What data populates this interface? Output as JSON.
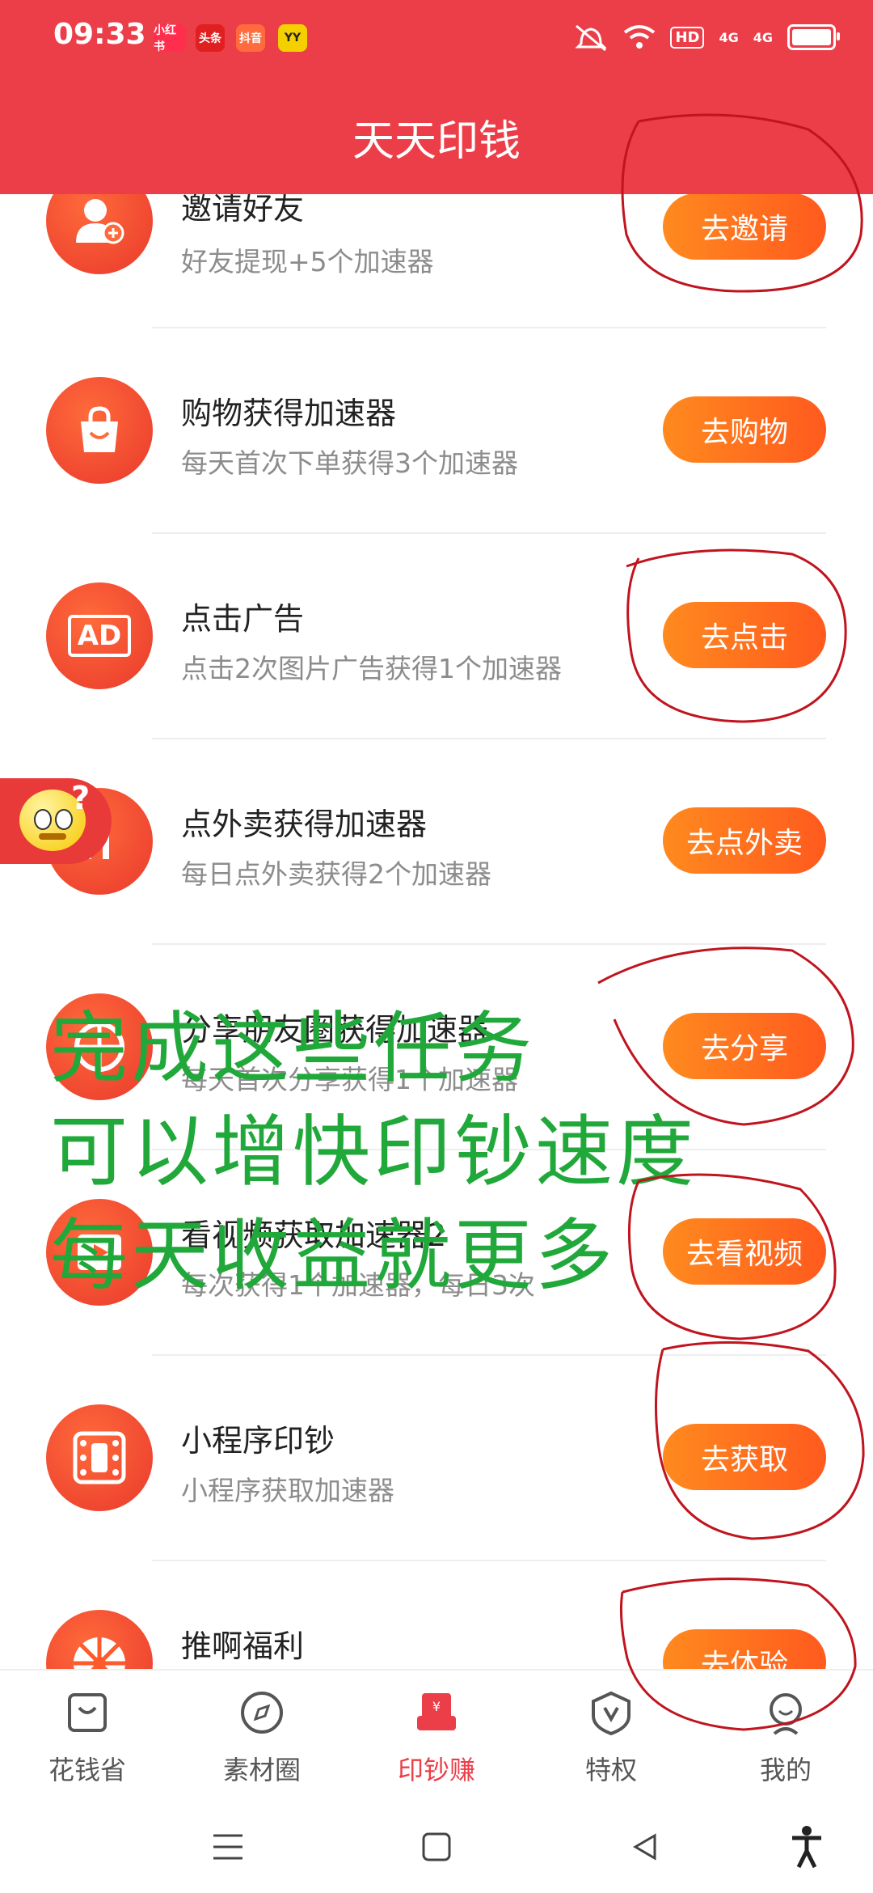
{
  "status_bar": {
    "time": "09:33",
    "notif_icons": [
      "小红书",
      "头条",
      "抖音",
      "YY"
    ],
    "hd_label": "HD",
    "signal1": "4G",
    "signal2": "4G"
  },
  "header": {
    "title": "天天印钱"
  },
  "tasks": [
    {
      "name": "邀请好友",
      "desc": "好友提现+5个加速器",
      "button": "去邀请",
      "icon": "add-user-icon"
    },
    {
      "name": "购物获得加速器",
      "desc": "每天首次下单获得3个加速器",
      "button": "去购物",
      "icon": "shopping-bag-icon"
    },
    {
      "name": "点击广告",
      "desc": "点击2次图片广告获得1个加速器",
      "button": "去点击",
      "icon": "ad-icon",
      "icon_text": "AD"
    },
    {
      "name": "点外卖获得加速器",
      "desc": "每日点外卖获得2个加速器",
      "button": "去点外卖",
      "icon": "food-delivery-icon"
    },
    {
      "name": "分享朋友圈获得加速器",
      "desc": "每天首次分享获得1个加速器",
      "button": "去分享",
      "icon": "moments-icon"
    },
    {
      "name": "看视频获取加速器2",
      "desc": "每次获得1个加速器，每日3次",
      "button": "去看视频",
      "icon": "video-icon"
    },
    {
      "name": "小程序印钞",
      "desc": "小程序获取加速器",
      "button": "去获取",
      "icon": "mini-program-icon"
    },
    {
      "name": "推啊福利",
      "desc": "",
      "button": "去体验",
      "icon": "wheel-icon"
    }
  ],
  "floating_widget": {
    "icon": "confused-emoji-icon",
    "mark": "?"
  },
  "overlay_text": [
    "完成这些任务",
    "可以增快印钞速度",
    "每天收益就更多"
  ],
  "tabbar": [
    {
      "label": "花钱省",
      "icon": "shopping-bag-icon",
      "active": false
    },
    {
      "label": "素材圈",
      "icon": "compass-icon",
      "active": false
    },
    {
      "label": "印钞赚",
      "icon": "red-envelope-icon",
      "active": true
    },
    {
      "label": "特权",
      "icon": "shield-v-icon",
      "active": false
    },
    {
      "label": "我的",
      "icon": "user-face-icon",
      "active": false
    }
  ],
  "colors": {
    "header": "#ec3e49",
    "button_start": "#ff8a1e",
    "button_end": "#ff5a1e",
    "overlay_text": "#21a83a",
    "annotation": "#c0141e"
  }
}
